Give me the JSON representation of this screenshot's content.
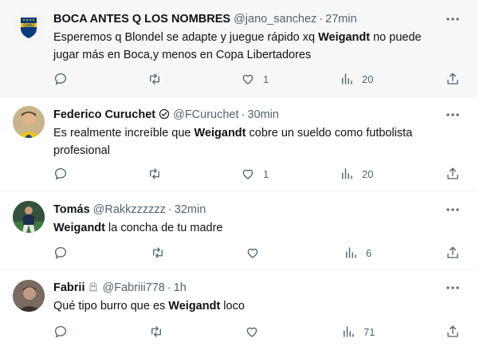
{
  "tweets": [
    {
      "name": "BOCA ANTES Q LOS NOMBRES",
      "handle": "@jano_sanchez",
      "time": "27min",
      "text_before": "Esperemos q Blondel se adapte y juegue rápido xq ",
      "highlight": "Weigandt",
      "text_after": " no puede jugar más en Boca,y menos en Copa Libertadores",
      "replies": "",
      "retweets": "",
      "likes": "1",
      "views": "20"
    },
    {
      "name": "Federico Curuchet",
      "handle": "@FCuruchet",
      "time": "30min",
      "text_before": "Es realmente increíble que ",
      "highlight": "Weigandt",
      "text_after": " cobre un sueldo como futbolista profesional",
      "replies": "",
      "retweets": "",
      "likes": "1",
      "views": "20"
    },
    {
      "name": "Tomás",
      "handle": "@Rakkzzzzzz",
      "time": "32min",
      "text_before": "",
      "highlight": "Weigandt",
      "text_after": " la concha de tu madre",
      "replies": "",
      "retweets": "",
      "likes": "",
      "views": "6"
    },
    {
      "name": "Fabrii",
      "handle": "@Fabriii778",
      "time": "1h",
      "text_before": "Qué tipo burro que es ",
      "highlight": "Weigandt",
      "text_after": " loco",
      "replies": "",
      "retweets": "",
      "likes": "",
      "views": "71"
    }
  ],
  "separator": "·",
  "colors": {
    "text": "#0f1419",
    "secondary": "#536471",
    "highlight_bg": "#f7f7f7",
    "divider": "#eff3f4",
    "boca_blue": "#0a3a7d",
    "boca_gold": "#f3c21b"
  },
  "icons": [
    "more-icon",
    "reply-icon",
    "retweet-icon",
    "like-icon",
    "views-icon",
    "share-icon",
    "verified-badge-icon",
    "ghost-emoji-icon"
  ]
}
